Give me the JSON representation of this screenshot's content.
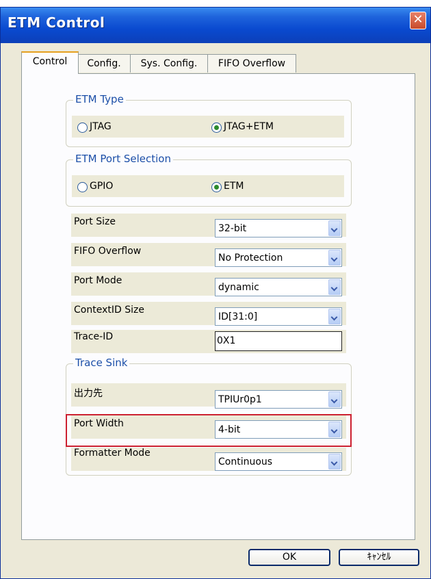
{
  "window": {
    "title": "ETM Control"
  },
  "tabs": [
    {
      "label": "Control"
    },
    {
      "label": "Config."
    },
    {
      "label": "Sys. Config."
    },
    {
      "label": "FIFO Overflow"
    }
  ],
  "etm_type": {
    "legend": "ETM Type",
    "options": [
      {
        "label": "JTAG",
        "selected": false
      },
      {
        "label": "JTAG+ETM",
        "selected": true
      }
    ]
  },
  "etm_port_selection": {
    "legend": "ETM Port Selection",
    "options": [
      {
        "label": "GPIO",
        "selected": false
      },
      {
        "label": "ETM",
        "selected": true
      }
    ]
  },
  "settings": {
    "port_size": {
      "label": "Port Size",
      "value": "32-bit"
    },
    "fifo_overflow": {
      "label": "FIFO Overflow",
      "value": "No Protection"
    },
    "port_mode": {
      "label": "Port Mode",
      "value": "dynamic"
    },
    "contextid_size": {
      "label": "ContextID Size",
      "value": "ID[31:0]"
    },
    "trace_id": {
      "label": "Trace-ID",
      "value": "0X1"
    }
  },
  "trace_sink": {
    "legend": "Trace Sink",
    "output_dest": {
      "label": "出力先",
      "value": "TPIUr0p1"
    },
    "port_width": {
      "label": "Port Width",
      "value": "4-bit"
    },
    "formatter_mode": {
      "label": "Formatter Mode",
      "value": "Continuous"
    }
  },
  "buttons": {
    "ok": "OK",
    "cancel": "ｷｬﾝｾﾙ"
  },
  "colors": {
    "title_bar": "#0a4ad0",
    "highlight": "#cc2030",
    "legend_text": "#1c4fa8"
  }
}
